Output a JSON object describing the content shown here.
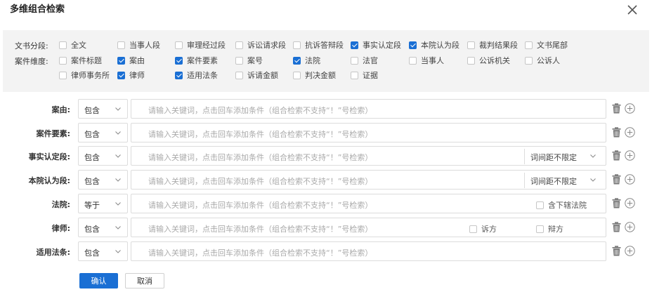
{
  "dialog": {
    "title": "多维组合检索"
  },
  "filters": {
    "segment_label": "文书分段:",
    "segments": [
      {
        "label": "全文",
        "checked": false
      },
      {
        "label": "当事人段",
        "checked": false
      },
      {
        "label": "审理经过段",
        "checked": false
      },
      {
        "label": "诉讼请求段",
        "checked": false
      },
      {
        "label": "抗诉答辩段",
        "checked": false
      },
      {
        "label": "事实认定段",
        "checked": true
      },
      {
        "label": "本院认为段",
        "checked": true
      },
      {
        "label": "裁判结果段",
        "checked": false
      },
      {
        "label": "文书尾部",
        "checked": false
      }
    ],
    "dimension_label": "案件维度:",
    "dimensions": [
      {
        "label": "案件标题",
        "checked": false
      },
      {
        "label": "案由",
        "checked": true
      },
      {
        "label": "案件要素",
        "checked": true
      },
      {
        "label": "案号",
        "checked": false
      },
      {
        "label": "法院",
        "checked": true
      },
      {
        "label": "法官",
        "checked": false
      },
      {
        "label": "当事人",
        "checked": false
      },
      {
        "label": "公诉机关",
        "checked": false
      },
      {
        "label": "公诉人",
        "checked": false
      },
      {
        "label": "律师事务所",
        "checked": false
      },
      {
        "label": "律师",
        "checked": true
      },
      {
        "label": "适用法条",
        "checked": true
      },
      {
        "label": "诉请金额",
        "checked": false
      },
      {
        "label": "判决金额",
        "checked": false
      },
      {
        "label": "证据",
        "checked": false
      }
    ]
  },
  "placeholder": "请输入关键词，点击回车添加条件（组合检索不支持“！”号检索）",
  "rows": [
    {
      "label": "案由:",
      "op": "包含"
    },
    {
      "label": "案件要素:",
      "op": "包含"
    },
    {
      "label": "事实认定段:",
      "op": "包含",
      "distance": "词间距不限定"
    },
    {
      "label": "本院认为段:",
      "op": "包含",
      "distance": "词间距不限定"
    },
    {
      "label": "法院:",
      "op": "等于",
      "extra": [
        "含下辖法院"
      ]
    },
    {
      "label": "律师:",
      "op": "包含",
      "extra": [
        "诉方",
        "辩方"
      ]
    },
    {
      "label": "适用法条:",
      "op": "包含"
    }
  ],
  "buttons": {
    "confirm": "确认",
    "cancel": "取消"
  },
  "colors": {
    "accent": "#1a6fd4",
    "panel_bg": "#f3f3f3"
  }
}
